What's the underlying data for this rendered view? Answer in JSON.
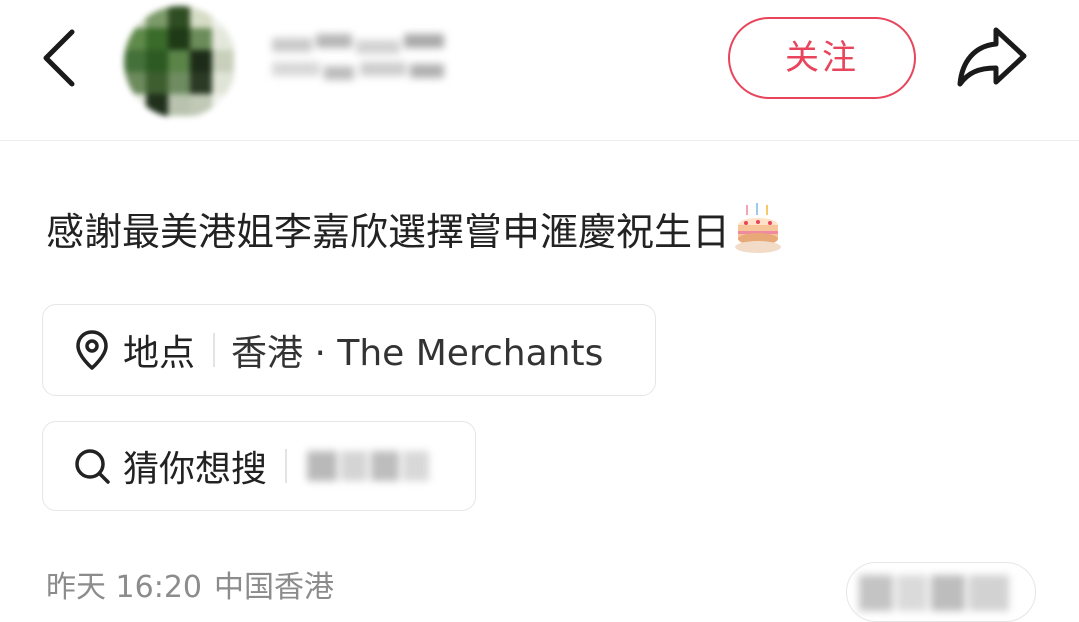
{
  "header": {
    "back_icon": "chevron-left-icon",
    "avatar": "blurred-avatar",
    "username": "",
    "follow_label": "关注",
    "share_icon": "share-arrow-icon",
    "accent_color": "#e8455c"
  },
  "post": {
    "title": "感謝最美港姐李嘉欣選擇嘗申滙慶祝生日",
    "emoji_icon": "birthday-cake-icon"
  },
  "location_chip": {
    "icon": "location-pin-icon",
    "label": "地点",
    "value": "香港 · The Merchants"
  },
  "search_chip": {
    "icon": "search-icon",
    "label": "猜你想搜",
    "value": ""
  },
  "meta": {
    "time": "昨天 16:20",
    "region": "中国香港"
  }
}
